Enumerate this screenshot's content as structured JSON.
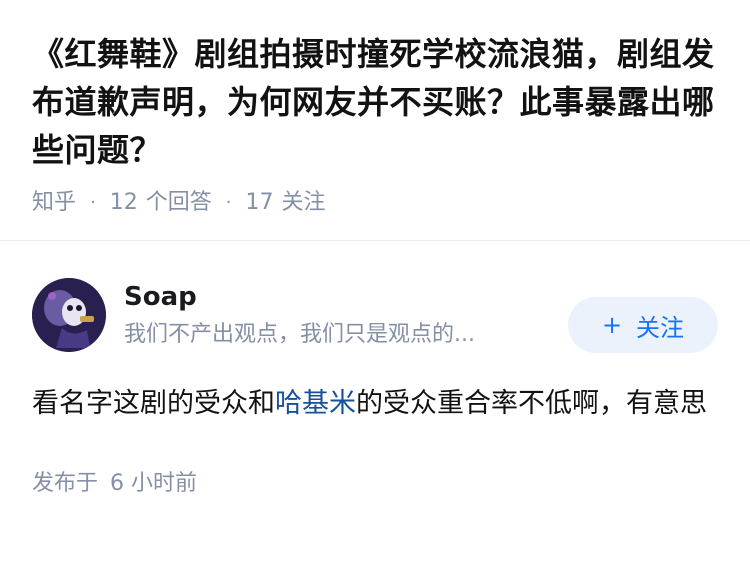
{
  "question": {
    "title": "《红舞鞋》剧组拍摄时撞死学校流浪猫，剧组发布道歉声明，为何网友并不买账？此事暴露出哪些问题？",
    "source": "知乎",
    "separator": "·",
    "answers_count": "12",
    "answers_label": "个回答",
    "followers_count": "17",
    "followers_label": "关注"
  },
  "answer": {
    "author": {
      "name": "Soap",
      "bio": "我们不产出观点，我们只是观点的...",
      "avatar_icon": "avatar-image"
    },
    "follow_button": {
      "plus": "+",
      "label": "关注"
    },
    "content": {
      "part1": "看名字这剧的受众和",
      "link": "哈基米",
      "part2": "的受众重合率不低啊，有意思"
    },
    "published_label": "发布于",
    "published_time": "6 小时前"
  },
  "colors": {
    "link": "#175199",
    "accent": "#1772f6",
    "meta": "#8590a6",
    "button_bg": "#ebf2fc"
  }
}
